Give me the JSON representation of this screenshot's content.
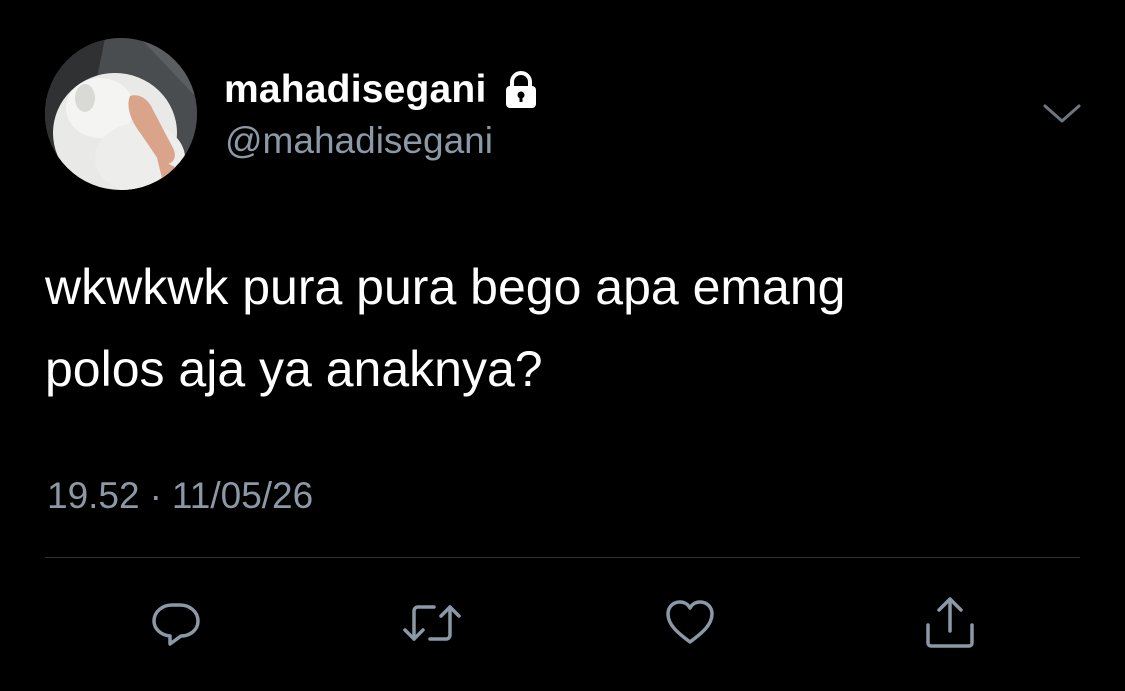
{
  "user": {
    "display_name": "mahadisegani",
    "handle": "@mahadisegani",
    "protected_icon": "lock-icon",
    "avatar": "white-dog-photo"
  },
  "tweet": {
    "lines": [
      "wkwkwk pura pura bego apa emang",
      "polos aja ya anaknya?"
    ],
    "time": "19.52",
    "separator": "·",
    "date": "11/05/26"
  },
  "actions": [
    {
      "icon": "reply-icon"
    },
    {
      "icon": "retweet-icon"
    },
    {
      "icon": "like-icon"
    },
    {
      "icon": "share-icon"
    }
  ],
  "menu_icon": "chevron-down-icon",
  "colors": {
    "background": "#000000",
    "primary_text": "#ffffff",
    "secondary_text": "#8b98a5",
    "divider": "#2f3336"
  }
}
